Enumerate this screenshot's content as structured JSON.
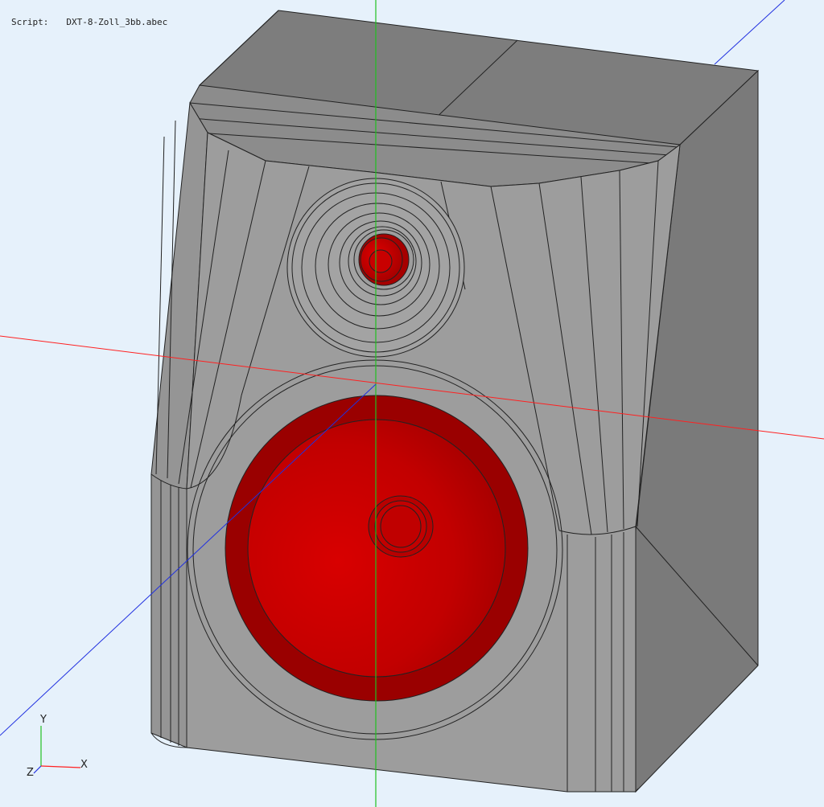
{
  "header": {
    "script_label": "Script:",
    "script_name": "DXT-8-Zoll_3bb.abec"
  },
  "axes_triad": {
    "x_label": "X",
    "y_label": "Y",
    "z_label": "Z",
    "colors": {
      "x": "#ff2020",
      "y": "#20c020",
      "z": "#2030e0"
    }
  },
  "colors": {
    "background": "#e6f1fb",
    "cabinet_front": "#9c9c9c",
    "cabinet_side": "#7a7a7a",
    "cabinet_top": "#808080",
    "driver_red": "#cc0000",
    "driver_dark_red": "#9a0000"
  }
}
